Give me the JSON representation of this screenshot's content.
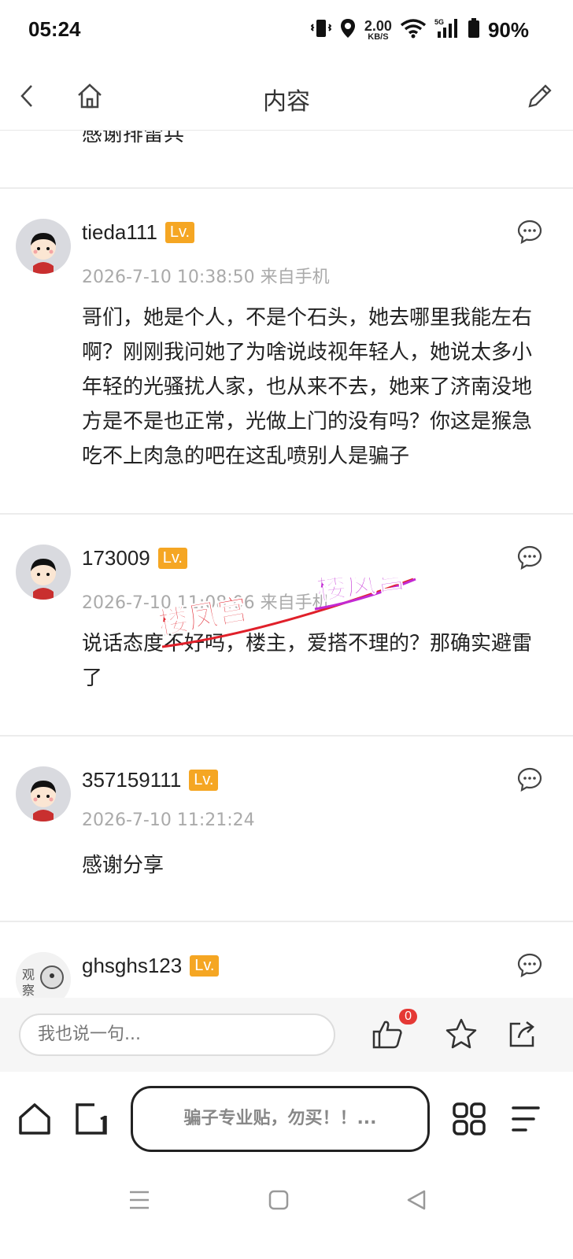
{
  "status": {
    "time": "05:24",
    "net_speed": "2.00",
    "net_unit": "KB/S",
    "battery": "90%"
  },
  "nav": {
    "title": "内容",
    "back_icon": "chevron-left-icon",
    "home_icon": "home-icon",
    "edit_icon": "pencil-icon"
  },
  "partial_text": "感谢排雷兵",
  "comments": [
    {
      "user": "tieda111",
      "lv": "Lv.",
      "time": "2026-7-10 10:38:50 来自手机",
      "text": "哥们，她是个人，不是个石头，她去哪里我能左右啊？刚刚我问她了为啥说歧视年轻人，她说太多小年轻的光骚扰人家，也从来不去，她来了济南没地方是不是也正常，光做上门的没有吗？你这是猴急吃不上肉急的吧在这乱喷别人是骗子"
    },
    {
      "user": "173009",
      "lv": "Lv.",
      "time": "2026-7-10 11:08:06 来自手机",
      "text": "说话态度不好吗，楼主，爱搭不理的？那确实避雷了"
    },
    {
      "user": "357159111",
      "lv": "Lv.",
      "time": "2026-7-10 11:21:24",
      "text": "感谢分享"
    },
    {
      "user": "ghsghs123",
      "lv": "Lv.",
      "time": "",
      "text": ""
    }
  ],
  "watermark": {
    "text": "楼凤宫"
  },
  "reply_bar": {
    "placeholder": "我也说一句...",
    "like_count": "0"
  },
  "browser_bar": {
    "search_text": "骗子专业贴，勿买！！..."
  },
  "colors": {
    "lv_badge": "#f5a623",
    "like_badge": "#e53935",
    "watermark_red": "#e0202a",
    "watermark_purple": "#c22ad4"
  }
}
